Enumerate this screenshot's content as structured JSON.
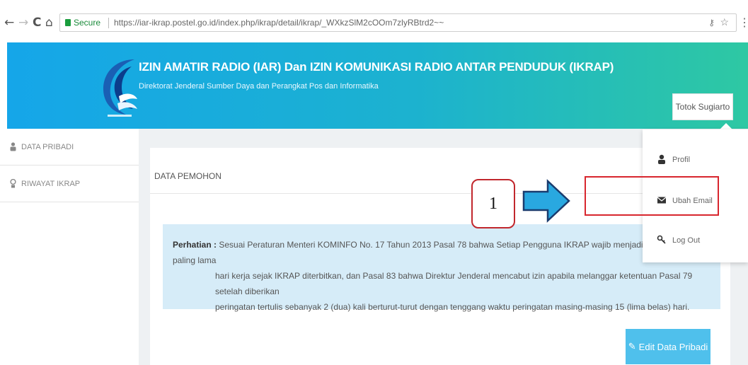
{
  "browser": {
    "secure_label": "Secure",
    "url": "https://iar-ikrap.postel.go.id/index.php/ikrap/detail/ikrap/_WXkzSlM2cOOm7zlyRBtrd2~~",
    "back_icon": "←",
    "forward_icon": "→",
    "reload_icon": "C",
    "home_icon": "⌂"
  },
  "header": {
    "title": "IZIN AMATIR RADIO (IAR) Dan IZIN KOMUNIKASI RADIO ANTAR PENDUDUK (IKRAP)",
    "subtitle": "Direktorat Jenderal Sumber Daya dan Perangkat Pos dan Informatika",
    "user_name": "Totok Sugiarto"
  },
  "sidebar": {
    "items": [
      {
        "label": "DATA PRIBADI",
        "icon": "user-icon"
      },
      {
        "label": "RIWAYAT IKRAP",
        "icon": "history-icon"
      }
    ]
  },
  "main": {
    "card_title": "DATA PEMOHON",
    "notice_label": "Perhatian :",
    "notice_text_1": " Sesuai Peraturan Menteri KOMINFO No. 17 Tahun 2013 Pasal 78 bahwa Setiap Pengguna IKRAP wajib menjadi anggota RAPI, paling lama",
    "notice_text_2": "hari kerja sejak IKRAP diterbitkan, dan Pasal 83 bahwa Direktur Jenderal mencabut izin apabila melanggar ketentuan Pasal 79 setelah diberikan",
    "notice_text_3": "peringatan tertulis sebanyak 2 (dua) kali berturut-turut dengan tenggang waktu peringatan masing-masing 15 (lima belas) hari.",
    "edit_button": "Edit Data Pribadi"
  },
  "dropdown": {
    "items": [
      {
        "label": "Profil",
        "icon": "user-icon"
      },
      {
        "label": "Ubah Email",
        "icon": "envelope-icon"
      },
      {
        "label": "Log Out",
        "icon": "logout-icon"
      }
    ]
  },
  "annotation": {
    "step_number": "1",
    "box_color": "#d8262e",
    "arrow_color": "#29a8e0"
  },
  "colors": {
    "header_start": "#15a6e9",
    "header_end": "#2ec8a3",
    "notice_bg": "#d6ecf8",
    "button": "#4fc0ec"
  }
}
